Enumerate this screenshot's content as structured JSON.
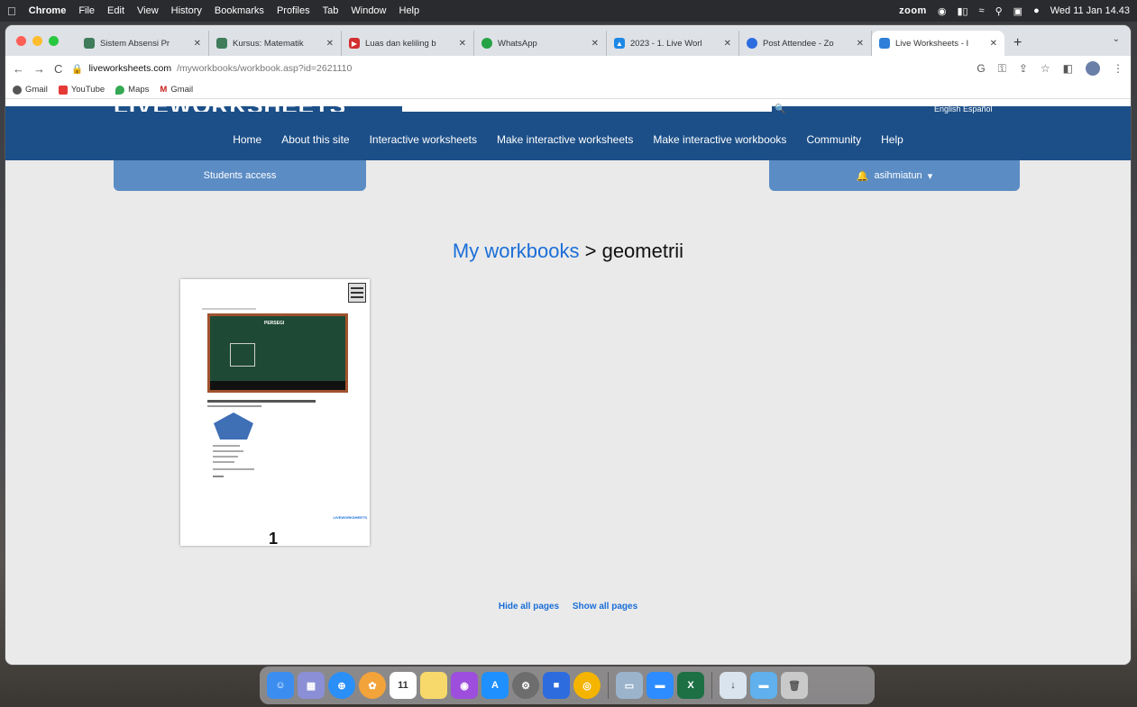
{
  "menubar": {
    "app": "Chrome",
    "items": [
      "File",
      "Edit",
      "View",
      "History",
      "Bookmarks",
      "Profiles",
      "Tab",
      "Window",
      "Help"
    ],
    "zoom": "zoom",
    "clock": "Wed 11 Jan 14.43"
  },
  "tabs": [
    {
      "title": "Sistem Absensi Pr",
      "color": "#3f7c5a"
    },
    {
      "title": "Kursus: Matematik",
      "color": "#3f7c5a"
    },
    {
      "title": "Luas dan keliling b",
      "color": "#d32f2f"
    },
    {
      "title": "WhatsApp",
      "color": "#25a244"
    },
    {
      "title": "2023 - 1. Live Worl",
      "color": "#1e88e5"
    },
    {
      "title": "Post Attendee - Zo",
      "color": "#2d6cdf"
    },
    {
      "title": "Live Worksheets - I",
      "color": "#2f7fd8"
    }
  ],
  "address": {
    "host": "liveworksheets.com",
    "path": "/myworkbooks/workbook.asp?id=2621110"
  },
  "bookmarks": [
    {
      "label": "Gmail",
      "color": "#555"
    },
    {
      "label": "YouTube",
      "color": "#e53935"
    },
    {
      "label": "Maps",
      "color": "#34a853"
    },
    {
      "label": "Gmail",
      "color": "#c5221f"
    }
  ],
  "site": {
    "logo": "LIVEWORKSHEETS",
    "languages": "English   Español",
    "nav": [
      "Home",
      "About this site",
      "Interactive worksheets",
      "Make interactive worksheets",
      "Make interactive workbooks",
      "Community",
      "Help"
    ],
    "students_access": "Students access",
    "username": "asihmiatun",
    "title_link": "My workbooks",
    "title_rest": " > geometrii",
    "thumb": {
      "video_title": "PERSEGI",
      "brand": "LIVEWORKSHEETS",
      "page_number": "1"
    },
    "hide_all": "Hide all pages",
    "show_all": "Show all pages"
  },
  "dock_icons": [
    "finder-icon",
    "launchpad-icon",
    "safari-icon",
    "photos-icon",
    "calendar-icon",
    "notes-icon",
    "podcasts-icon",
    "app-store-icon",
    "settings-icon",
    "zoom-icon",
    "chrome-icon",
    "preview-icon",
    "zoom-app-icon",
    "excel-icon",
    "downloads-icon",
    "folder-icon",
    "trash-icon"
  ],
  "calendar_day": "11"
}
